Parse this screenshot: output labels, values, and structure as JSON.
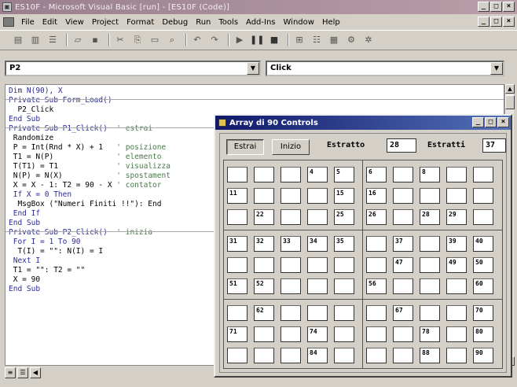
{
  "window": {
    "title": "ES10F - Microsoft Visual Basic [run] - [ES10F (Code)]",
    "controls": [
      "_",
      "□",
      "×"
    ]
  },
  "menu": [
    "File",
    "Edit",
    "View",
    "Project",
    "Format",
    "Debug",
    "Run",
    "Tools",
    "Add-Ins",
    "Window",
    "Help"
  ],
  "code_window": {
    "object_combo": "P2",
    "procedure_combo": "Click",
    "lines": [
      {
        "code": "Dim N(90), X",
        "comment": ""
      },
      {
        "code": "Private Sub Form_Load()",
        "comment": ""
      },
      {
        "code": "  P2_Click",
        "comment": ""
      },
      {
        "code": "End Sub",
        "comment": ""
      },
      {
        "code": "Private Sub P1_Click()",
        "comment": "' estrai"
      },
      {
        "code": " Randomize",
        "comment": ""
      },
      {
        "code": " P = Int(Rnd * X) + 1",
        "comment": "' posizione"
      },
      {
        "code": " T1 = N(P)",
        "comment": "' elemento"
      },
      {
        "code": " T(T1) = T1",
        "comment": "' visualizza"
      },
      {
        "code": " N(P) = N(X)",
        "comment": "' spostament"
      },
      {
        "code": " X = X - 1: T2 = 90 - X",
        "comment": "' contator"
      },
      {
        "code": " If X = 0 Then",
        "comment": ""
      },
      {
        "code": "  MsgBox (\"Numeri Finiti !!\"): End",
        "comment": ""
      },
      {
        "code": " End If",
        "comment": ""
      },
      {
        "code": "End Sub",
        "comment": ""
      },
      {
        "code": "Private Sub P2_Click()",
        "comment": "' inizia"
      },
      {
        "code": " For I = 1 To 90",
        "comment": ""
      },
      {
        "code": "  T(I) = \"\": N(I) = I",
        "comment": ""
      },
      {
        "code": " Next I",
        "comment": ""
      },
      {
        "code": " T1 = \"\": T2 = \"\"",
        "comment": ""
      },
      {
        "code": " X = 90",
        "comment": ""
      },
      {
        "code": "End Sub",
        "comment": ""
      }
    ]
  },
  "form": {
    "title": "Array di 90 Controls",
    "controls": [
      "_",
      "□",
      "×"
    ],
    "extract_button": "Estrai",
    "start_button": "Inizio",
    "extracted_label": "Estratto",
    "extracted_value": "28",
    "count_label": "Estratti",
    "count_value": "37",
    "grid": [
      [
        "",
        "",
        "",
        "4",
        "5",
        "6",
        "",
        "8",
        "",
        ""
      ],
      [
        "11",
        "",
        "",
        "",
        "15",
        "16",
        "",
        "",
        "",
        ""
      ],
      [
        "",
        "22",
        "",
        "",
        "25",
        "26",
        "",
        "28",
        "29",
        ""
      ],
      [
        "31",
        "32",
        "33",
        "34",
        "35",
        "",
        "37",
        "",
        "39",
        "40"
      ],
      [
        "",
        "",
        "",
        "",
        "",
        "",
        "47",
        "",
        "49",
        "50"
      ],
      [
        "51",
        "52",
        "",
        "",
        "",
        "56",
        "",
        "",
        "",
        "60"
      ],
      [
        "",
        "62",
        "",
        "",
        "",
        "",
        "67",
        "",
        "",
        "70"
      ],
      [
        "71",
        "",
        "",
        "74",
        "",
        "",
        "",
        "78",
        "",
        "80"
      ],
      [
        "",
        "",
        "",
        "84",
        "",
        "",
        "",
        "88",
        "",
        "90"
      ]
    ]
  }
}
